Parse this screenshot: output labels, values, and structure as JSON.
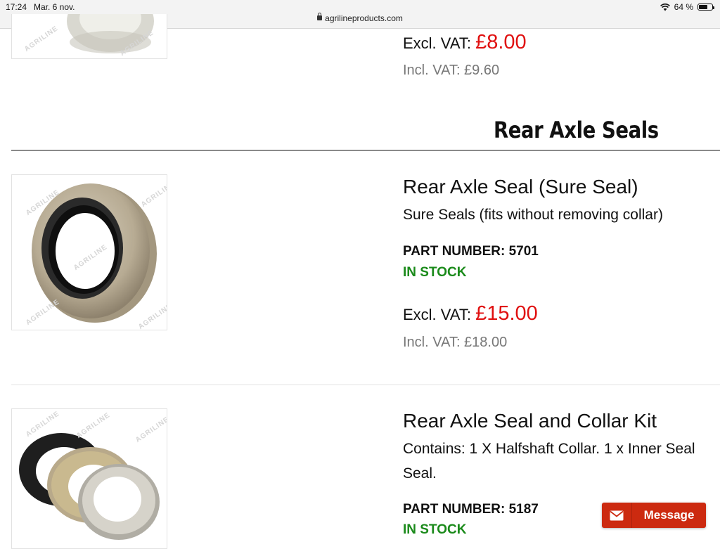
{
  "status_bar": {
    "time": "17:24",
    "date": "Mar. 6 nov.",
    "battery": "64 %",
    "battery_level": 0.64
  },
  "url_bar": {
    "url": "agrilineproducts.com"
  },
  "watermark": "AGRILINE",
  "prev_product": {
    "excl_label": "Excl. VAT:",
    "excl_price": "£8.00",
    "incl_text": "Incl. VAT: £9.60"
  },
  "section": {
    "title": "Rear Axle Seals"
  },
  "products": [
    {
      "title": "Rear Axle Seal (Sure Seal)",
      "description": "Sure Seals (fits without removing collar)",
      "part_label": "PART NUMBER:",
      "part_number": "5701",
      "stock": "IN STOCK",
      "excl_label": "Excl. VAT:",
      "excl_price": "£15.00",
      "incl_text": "Incl. VAT: £18.00"
    },
    {
      "title": "Rear Axle Seal and Collar Kit",
      "description_line1": "Contains: 1 X Halfshaft Collar. 1 x Inner Seal",
      "description_line2": "Seal.",
      "part_label": "PART NUMBER:",
      "part_number": "5187",
      "stock": "IN STOCK"
    }
  ],
  "chat_button": {
    "label": "Message",
    "icon": "envelope-icon",
    "color": "#cc2a10"
  },
  "colors": {
    "price": "#e01010",
    "in_stock": "#1a8a1a",
    "incl_vat": "#777777"
  }
}
